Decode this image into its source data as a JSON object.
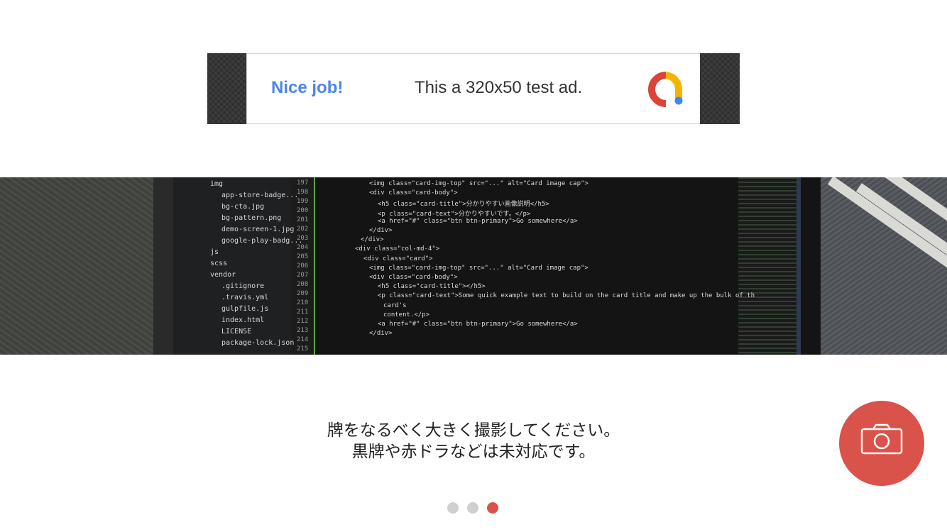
{
  "ad": {
    "headline": "Nice job!",
    "body": "This a 320x50 test ad.",
    "logo_icon": "admob-logo-icon"
  },
  "photo": {
    "description_icon": "camera-preview-image",
    "file_tree": [
      "img",
      "app-store-badge...",
      "bg-cta.jpg",
      "bg-pattern.png",
      "demo-screen-1.jpg",
      "google-play-badg...",
      "js",
      "scss",
      "vendor",
      ".gitignore",
      ".travis.yml",
      "gulpfile.js",
      "index.html",
      "LICENSE",
      "package-lock.json"
    ],
    "line_numbers": [
      "197",
      "198",
      "199",
      "200",
      "201",
      "202",
      "203",
      "204",
      "205",
      "206",
      "207",
      "208",
      "209",
      "210",
      "211",
      "212",
      "213",
      "214",
      "215"
    ],
    "code_lines": [
      "<img class=\"card-img-top\" src=\"...\" alt=\"Card image cap\">",
      "<div class=\"card-body\">",
      "<h5 class=\"card-title\">分かりやすい画像説明</h5>",
      "<p class=\"card-text\">分かりやすいです。</p>",
      "<a href=\"#\" class=\"btn btn-primary\">Go somewhere</a>",
      "</div>",
      "</div>",
      "<div class=\"col-md-4\">",
      "<div class=\"card\">",
      "<img class=\"card-img-top\" src=\"...\" alt=\"Card image cap\">",
      "<div class=\"card-body\">",
      "<h5 class=\"card-title\"></h5>",
      "<p class=\"card-text\">Some quick example text to build on the card title and make up the bulk of th",
      "card's",
      "content.</p>",
      "<a href=\"#\" class=\"btn btn-primary\">Go somewhere</a>",
      "</div>"
    ]
  },
  "instructions": {
    "line1": "牌をなるべく大きく撮影してください。",
    "line2": "黒牌や赤ドラなどは未対応です。"
  },
  "camera_button": {
    "icon": "camera-icon",
    "color": "#d9534a"
  },
  "pager": {
    "count": 3,
    "active_index": 2,
    "active_color": "#d9534a",
    "inactive_color": "#cfcfcf"
  }
}
